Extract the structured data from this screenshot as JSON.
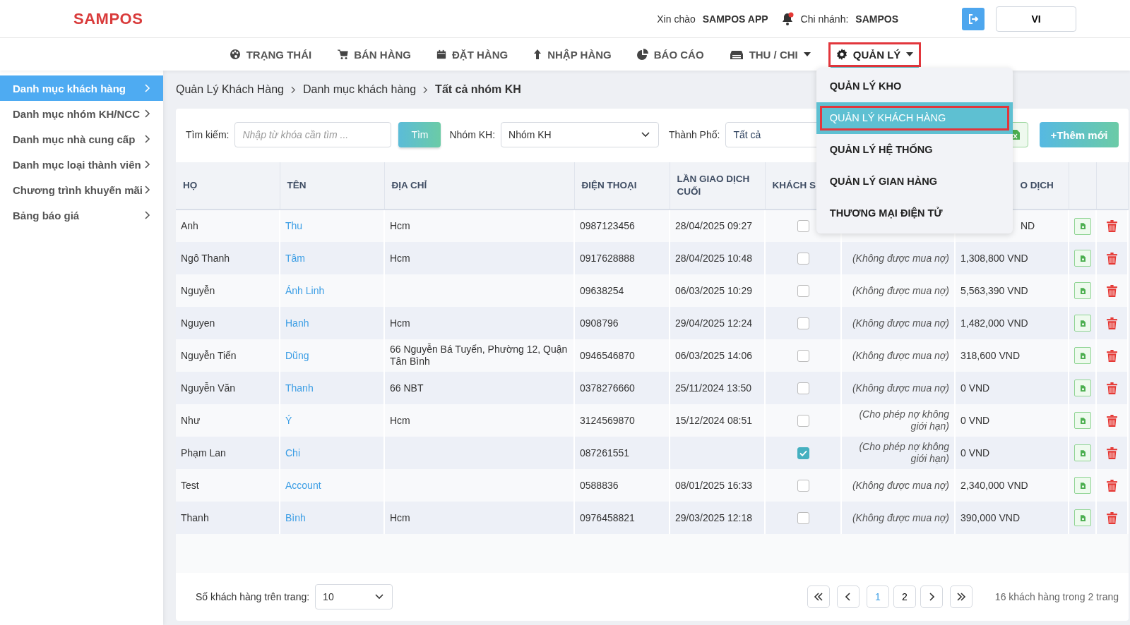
{
  "header": {
    "logo": "SAMPOS",
    "greeting": "Xin chào",
    "user": "SAMPOS APP",
    "branch_label": "Chi nhánh:",
    "branch": "SAMPOS",
    "language": "VI"
  },
  "nav": [
    {
      "label": "TRẠNG THÁI",
      "selected": false,
      "dropdown": false,
      "expanded": false
    },
    {
      "label": "BÁN HÀNG",
      "selected": false,
      "dropdown": false,
      "expanded": false
    },
    {
      "label": "ĐẶT HÀNG",
      "selected": false,
      "dropdown": false,
      "expanded": false
    },
    {
      "label": "NHẬP HÀNG",
      "selected": false,
      "dropdown": false,
      "expanded": false
    },
    {
      "label": "BÁO CÁO",
      "selected": false,
      "dropdown": false,
      "expanded": false
    },
    {
      "label": "THU / CHI",
      "selected": false,
      "dropdown": true,
      "expanded": false
    },
    {
      "label": "QUẢN LÝ",
      "selected": true,
      "dropdown": true,
      "expanded": true
    }
  ],
  "menu": [
    {
      "label": "QUẢN LÝ KHO",
      "selected": false
    },
    {
      "label": "QUẢN LÝ KHÁCH HÀNG",
      "selected": true
    },
    {
      "label": "QUẢN LÝ HỆ THỐNG",
      "selected": false
    },
    {
      "label": "QUẢN LÝ GIAN HÀNG",
      "selected": false
    },
    {
      "label": "THƯƠNG MẠI ĐIỆN TỬ",
      "selected": false
    }
  ],
  "sidebar": {
    "items": [
      {
        "label": "Danh mục khách hàng",
        "selected": true
      },
      {
        "label": "Danh mục nhóm KH/NCC",
        "selected": false
      },
      {
        "label": "Danh mục nhà cung cấp",
        "selected": false
      },
      {
        "label": "Danh mục loại thành viên",
        "selected": false
      },
      {
        "label": "Chương trình khuyến mãi",
        "selected": false
      },
      {
        "label": "Bảng báo giá",
        "selected": false
      }
    ]
  },
  "breadcrumb": [
    "Quản Lý Khách Hàng",
    "Danh mục khách hàng",
    "Tất cả nhóm KH"
  ],
  "filters": {
    "search_label": "Tìm kiếm:",
    "search_placeholder": "Nhập từ khóa cần tìm ...",
    "search_button": "Tìm",
    "group_label": "Nhóm KH:",
    "group_value": "Nhóm KH",
    "city_label": "Thành Phố:",
    "city_value": "Tất cả",
    "add_button": "+Thêm mới"
  },
  "table": {
    "columns": [
      "HỌ",
      "TÊN",
      "ĐỊA CHỈ",
      "ĐIỆN THOẠI",
      "LẦN GIAO DỊCH CUỐI",
      "KHÁCH S",
      "O DỊCH"
    ],
    "rows": [
      {
        "last_name": "Anh",
        "first_name": "Thu",
        "address": "Hcm",
        "phone": "0987123456",
        "last_transaction": "28/04/2025 09:27",
        "wholesale": false,
        "amount": "ND"
      },
      {
        "last_name": "Ngô Thanh",
        "first_name": "Tâm",
        "address": "Hcm",
        "phone": "0917628888",
        "last_transaction": "28/04/2025 10:48",
        "wholesale": false,
        "credit": "(Không được mua nợ)",
        "amount": "1,308,800 VND"
      },
      {
        "last_name": "Nguyễn",
        "first_name": "Ánh Linh",
        "phone": "09638254",
        "last_transaction": "06/03/2025 10:29",
        "wholesale": false,
        "credit": "(Không được mua nợ)",
        "amount": "5,563,390 VND"
      },
      {
        "last_name": "Nguyen",
        "first_name": "Hanh",
        "address": "Hcm",
        "phone": "0908796",
        "last_transaction": "29/04/2025 12:24",
        "wholesale": false,
        "credit": "(Không được mua nợ)",
        "amount": "1,482,000 VND"
      },
      {
        "last_name": "Nguyễn Tiến",
        "first_name": "Dũng",
        "address": "66 Nguyễn Bá Tuyển, Phường 12, Quận Tân Bình",
        "phone": "0946546870",
        "last_transaction": "06/03/2025 14:06",
        "wholesale": false,
        "credit": "(Không được mua nợ)",
        "amount": "318,600 VND"
      },
      {
        "last_name": "Nguyễn Văn",
        "first_name": "Thanh",
        "address": "66 NBT",
        "phone": "0378276660",
        "last_transaction": "25/11/2024 13:50",
        "wholesale": false,
        "credit": "(Không được mua nợ)",
        "amount": "0 VND"
      },
      {
        "last_name": "Như",
        "first_name": "Ý",
        "address": "Hcm",
        "phone": "3124569870",
        "last_transaction": "15/12/2024 08:51",
        "wholesale": false,
        "credit": "(Cho phép nợ không giới hạn)",
        "amount": "0 VND"
      },
      {
        "last_name": "Phạm Lan",
        "first_name": "Chi",
        "phone": "087261551",
        "wholesale": true,
        "credit": "(Cho phép nợ không giới hạn)",
        "amount": "0 VND"
      },
      {
        "last_name": "Test",
        "first_name": "Account",
        "phone": "0588836",
        "last_transaction": "08/01/2025 16:33",
        "wholesale": false,
        "credit": "(Không được mua nợ)",
        "amount": "2,340,000 VND"
      },
      {
        "last_name": "Thanh",
        "first_name": "Bình",
        "address": "Hcm",
        "phone": "0976458821",
        "last_transaction": "29/03/2025 12:18",
        "wholesale": false,
        "credit": "(Không được mua nợ)",
        "amount": "390,000 VND"
      }
    ]
  },
  "footer": {
    "per_page_label": "Số khách hàng trên trang:",
    "per_page": "10",
    "pages": [
      {
        "label": "1",
        "selected": true
      },
      {
        "label": "2",
        "selected": false
      }
    ],
    "summary": "16 khách hàng trong 2 trang"
  }
}
